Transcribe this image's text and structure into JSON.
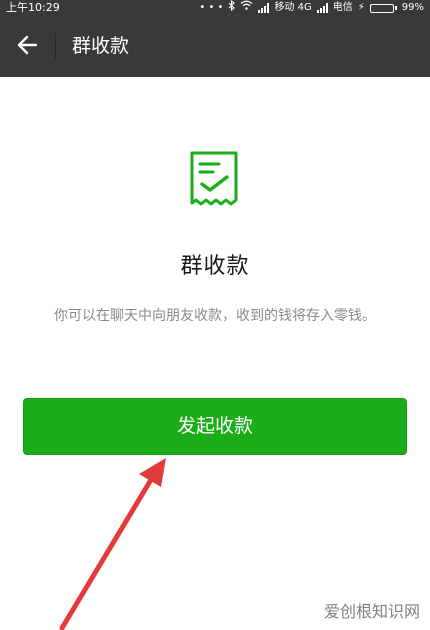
{
  "status_bar": {
    "time": "上午10:29",
    "indicators": "• • • ",
    "carrier1": "移动 4G",
    "carrier2": "电信",
    "charging_glyph": "⚡",
    "battery": "99%",
    "battery_level": 0.99,
    "battery_color": "#5bd03b"
  },
  "nav": {
    "back_icon": "back-arrow-icon",
    "title": "群收款",
    "background": "#39393c"
  },
  "content": {
    "logo_icon": "receipt-check-icon",
    "heading": "群收款",
    "description": "你可以在聊天中向朋友收款，收到的钱将存入零钱。",
    "button_label": "发起收款",
    "accent_color": "#1aad19"
  },
  "watermark": "爱创根知识网"
}
